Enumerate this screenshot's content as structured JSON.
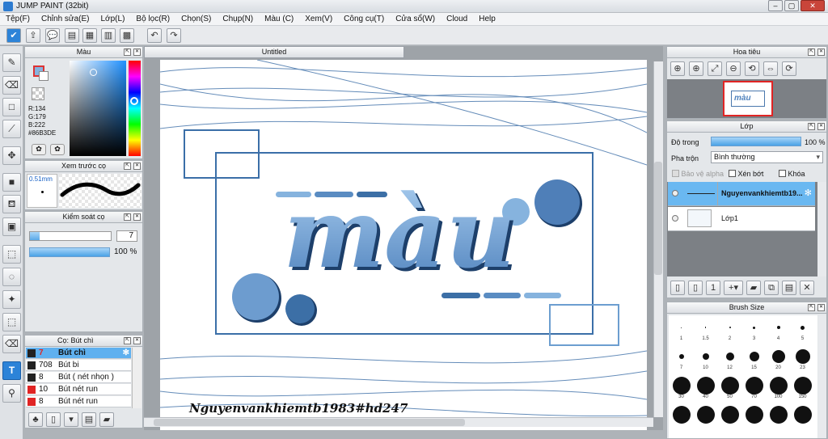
{
  "window": {
    "title": "JUMP PAINT (32bit)"
  },
  "menu": [
    "Tệp(F)",
    "Chỉnh sửa(E)",
    "Lớp(L)",
    "Bộ lọc(R)",
    "Chọn(S)",
    "Chụp(N)",
    "Màu (C)",
    "Xem(V)",
    "Công cụ(T)",
    "Cửa sổ(W)",
    "Cloud",
    "Help"
  ],
  "document": {
    "tab": "Untitled",
    "watermark": "Nguyenvankhiemtb1983#hd247",
    "artwork_text": "màu"
  },
  "color_panel": {
    "title": "Màu",
    "r": "R:134",
    "g": "G:179",
    "b": "B:222",
    "hex": "#86B3DE",
    "main_color": "#86b3de"
  },
  "brush_preview": {
    "title": "Xem trước cọ",
    "size": "0.51mm"
  },
  "brush_control": {
    "title": "Kiểm soát cọ",
    "size_value": "7",
    "opacity": "100 %"
  },
  "brush_list": {
    "title": "Cọ: Bút chì",
    "items": [
      {
        "size": "7",
        "name": "Bút chì",
        "color": "#222222"
      },
      {
        "size": "708",
        "name": "Bút bi",
        "color": "#222222"
      },
      {
        "size": "8",
        "name": "Bút ( nét nhọn )",
        "color": "#222222"
      },
      {
        "size": "10",
        "name": "Bút nét run",
        "color": "#e02424"
      },
      {
        "size": "8",
        "name": "Bút nét run",
        "color": "#e02424"
      }
    ]
  },
  "navigator": {
    "title": "Hoa tiêu"
  },
  "layer_panel": {
    "title": "Lớp",
    "opacity_label": "Độ trong",
    "opacity_value": "100 %",
    "blend_label": "Pha trộn",
    "blend_value": "Bình thường",
    "protect_alpha": "Bảo vệ alpha",
    "clipping": "Xén bớt",
    "lock": "Khóa",
    "layers": [
      {
        "name": "Nguyenvankhiemtb19..."
      },
      {
        "name": "Lớp1"
      }
    ]
  },
  "brush_size": {
    "title": "Brush Size",
    "labels": [
      "1",
      "1.5",
      "2",
      "3",
      "4",
      "5",
      "7",
      "10",
      "12",
      "15",
      "20",
      "23",
      "30",
      "40",
      "50",
      "70",
      "100",
      "150"
    ]
  }
}
